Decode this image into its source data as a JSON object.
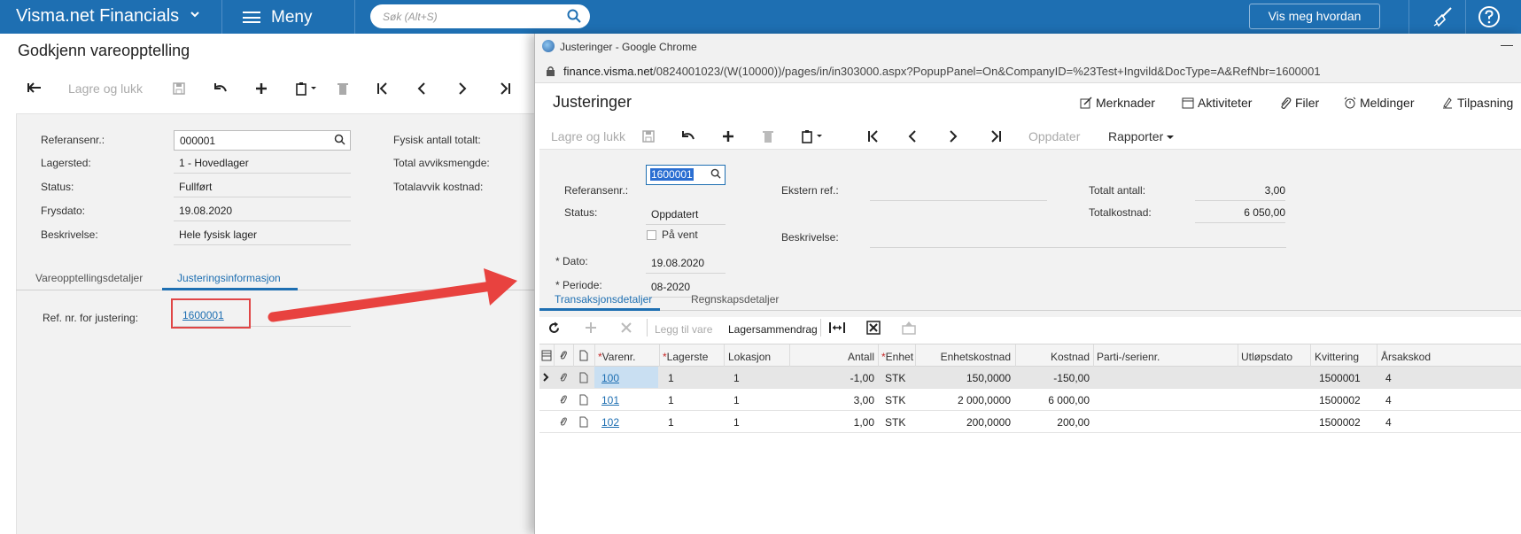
{
  "topbar": {
    "brand": "Visma.net Financials",
    "menu_label": "Meny",
    "search_placeholder": "Søk (Alt+S)",
    "show_me_how": "Vis meg hvordan"
  },
  "left": {
    "title": "Godkjenn vareopptelling",
    "save_close": "Lagre og lukk",
    "fields": {
      "ref_label": "Referansenr.:",
      "ref_value": "000001",
      "warehouse_label": "Lagersted:",
      "warehouse_value": "1 - Hovedlager",
      "status_label": "Status:",
      "status_value": "Fullført",
      "freeze_label": "Frysdato:",
      "freeze_value": "19.08.2020",
      "desc_label": "Beskrivelse:",
      "desc_value": "Hele fysisk lager",
      "phys_total_label": "Fysisk antall totalt:",
      "total_dev_label": "Total avviksmengde:",
      "total_dev_cost_label": "Totalavvik kostnad:"
    },
    "tabs": [
      "Vareopptellingsdetaljer",
      "Justeringsinformasjon"
    ],
    "adj_ref_label": "Ref. nr. for justering:",
    "adj_ref_value": "1600001"
  },
  "popup": {
    "window_title": "Justeringer - Google Chrome",
    "url_host": "finance.visma.net",
    "url_path": "/0824001023/(W(10000))/pages/in/in303000.aspx?PopupPanel=On&CompanyID=%23Test+Ingvild&DocType=A&RefNbr=1600001",
    "title": "Justeringer",
    "actions": [
      "Merknader",
      "Aktiviteter",
      "Filer",
      "Meldinger",
      "Tilpasning"
    ],
    "save_close": "Lagre og lukk",
    "update": "Oppdater",
    "reports": "Rapporter",
    "fields": {
      "ref_label": "Referansenr.:",
      "ref_value": "1600001",
      "status_label": "Status:",
      "status_value": "Oppdatert",
      "on_hold_label": "På vent",
      "date_label": "Dato:",
      "date_value": "19.08.2020",
      "period_label": "Periode:",
      "period_value": "08-2020",
      "ext_ref_label": "Ekstern ref.:",
      "desc_label": "Beskrivelse:",
      "total_qty_label": "Totalt antall:",
      "total_qty_value": "3,00",
      "total_cost_label": "Totalkostnad:",
      "total_cost_value": "6 050,00"
    },
    "tabs": [
      "Transaksjonsdetaljer",
      "Regnskapsdetaljer"
    ],
    "grid_tools": {
      "add_item": "Legg til vare",
      "inventory_summary": "Lagersammendrag"
    },
    "columns": [
      "Varenr.",
      "Lagerste",
      "Lokasjon",
      "Antall",
      "Enhet",
      "Enhetskostnad",
      "Kostnad",
      "Parti-/serienr.",
      "Utløpsdato",
      "Kvittering",
      "Årsakskod"
    ],
    "rows": [
      {
        "item": "100",
        "wh": "1",
        "loc": "1",
        "qty": "-1,00",
        "uom": "STK",
        "unit_cost": "150,0000",
        "cost": "-150,00",
        "lot": "",
        "exp": "",
        "receipt": "1500001",
        "reason": "4"
      },
      {
        "item": "101",
        "wh": "1",
        "loc": "1",
        "qty": "3,00",
        "uom": "STK",
        "unit_cost": "2 000,0000",
        "cost": "6 000,00",
        "lot": "",
        "exp": "",
        "receipt": "1500002",
        "reason": "4"
      },
      {
        "item": "102",
        "wh": "1",
        "loc": "1",
        "qty": "1,00",
        "uom": "STK",
        "unit_cost": "200,0000",
        "cost": "200,00",
        "lot": "",
        "exp": "",
        "receipt": "1500002",
        "reason": "4"
      }
    ]
  },
  "colors": {
    "brand_blue": "#1e6fb2",
    "highlight_red": "#e04646",
    "arrow_red": "#e8423f"
  }
}
